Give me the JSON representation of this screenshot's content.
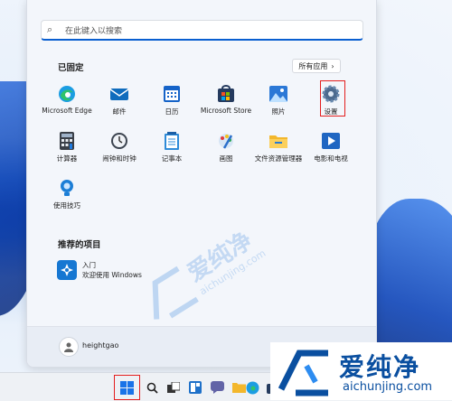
{
  "search": {
    "placeholder": "在此键入以搜索"
  },
  "pinned": {
    "title": "已固定",
    "all_apps": "所有应用",
    "all_apps_chevron": "›"
  },
  "apps": [
    {
      "label": "Microsoft Edge",
      "icon": "edge-icon"
    },
    {
      "label": "邮件",
      "icon": "mail-icon"
    },
    {
      "label": "日历",
      "icon": "calendar-icon"
    },
    {
      "label": "Microsoft Store",
      "icon": "store-icon"
    },
    {
      "label": "照片",
      "icon": "photos-icon"
    },
    {
      "label": "设置",
      "icon": "settings-icon"
    },
    {
      "label": "计算器",
      "icon": "calculator-icon"
    },
    {
      "label": "闹钟和时钟",
      "icon": "clock-icon"
    },
    {
      "label": "记事本",
      "icon": "notepad-icon"
    },
    {
      "label": "画图",
      "icon": "paint-icon"
    },
    {
      "label": "文件资源管理器",
      "icon": "folder-icon"
    },
    {
      "label": "电影和电视",
      "icon": "movies-icon"
    },
    {
      "label": "使用技巧",
      "icon": "tips-icon"
    }
  ],
  "recommended": {
    "title": "推荐的项目",
    "items": [
      {
        "title": "入门",
        "subtitle": "欢迎使用 Windows",
        "icon": "get-started-icon"
      }
    ]
  },
  "user": {
    "name": "heightgao"
  },
  "watermark": {
    "text": "爱纯净",
    "url": "aichunjing.com"
  },
  "colors": {
    "accent": "#0a5fd0",
    "highlight": "#e41e1e"
  }
}
